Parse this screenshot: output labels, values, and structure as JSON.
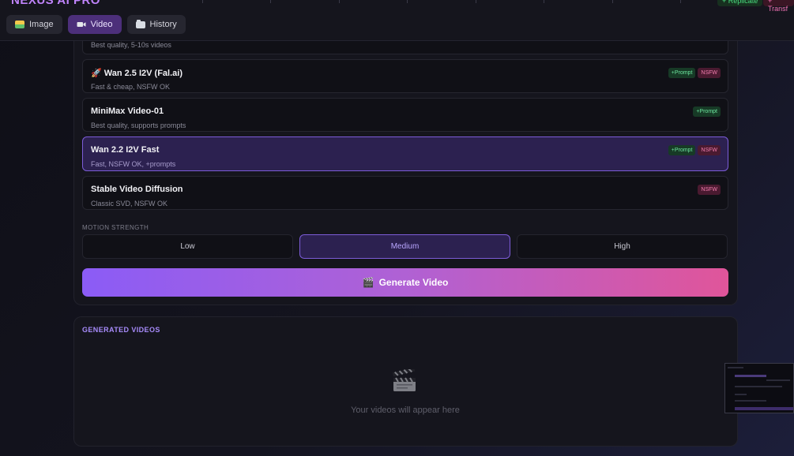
{
  "app": {
    "brand": "NEXUS AI PRO"
  },
  "topbar": {
    "badge_replicate": "+ Replicate",
    "badge_right": "+ Transf"
  },
  "tabs": [
    {
      "label": "Image",
      "icon": "image-icon",
      "active": false
    },
    {
      "label": "Video",
      "icon": "video-camera-icon",
      "active": true
    },
    {
      "label": "History",
      "icon": "folder-icon",
      "active": false
    }
  ],
  "models": [
    {
      "title": "",
      "subtitle": "Best quality, 5-10s videos",
      "badges": []
    },
    {
      "title": "🚀 Wan 2.5 I2V (Fal.ai)",
      "subtitle": "Fast & cheap, NSFW OK",
      "badges": [
        "+Prompt",
        "NSFW"
      ]
    },
    {
      "title": "MiniMax Video-01",
      "subtitle": "Best quality, supports prompts",
      "badges": [
        "+Prompt"
      ]
    },
    {
      "title": "Wan 2.2 I2V Fast",
      "subtitle": "Fast, NSFW OK, +prompts",
      "badges": [
        "+Prompt",
        "NSFW"
      ],
      "selected": true
    },
    {
      "title": "Stable Video Diffusion",
      "subtitle": "Classic SVD, NSFW OK",
      "badges": [
        "NSFW"
      ]
    }
  ],
  "motion": {
    "label": "MOTION STRENGTH",
    "options": [
      "Low",
      "Medium",
      "High"
    ],
    "selected": "Medium"
  },
  "generate": {
    "icon": "🎬",
    "label": "Generate Video"
  },
  "generated": {
    "title": "GENERATED VIDEOS",
    "empty_icon": "clapperboard-icon",
    "empty_text": "Your videos will appear here"
  },
  "colors": {
    "accent": "#7c5cd8",
    "gradient_start": "#8b5cf6",
    "gradient_end": "#e0559a",
    "prompt_badge": "#6ee7a0",
    "nsfw_badge": "#f47fb0"
  }
}
